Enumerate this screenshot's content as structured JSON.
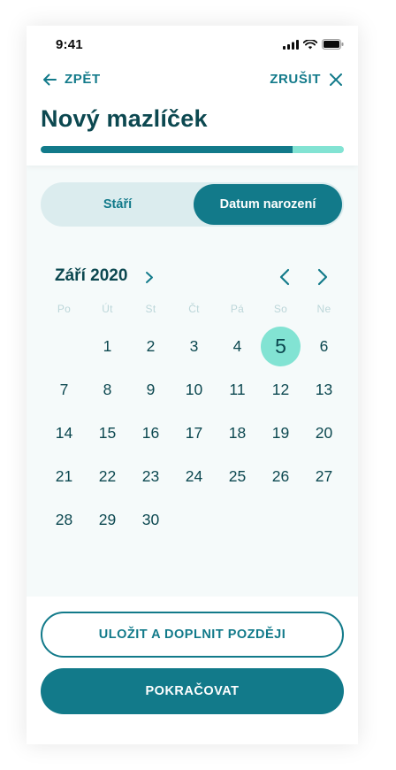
{
  "status": {
    "time": "9:41"
  },
  "nav": {
    "back_label": "ZPĚT",
    "cancel_label": "ZRUŠIT"
  },
  "header": {
    "title": "Nový mazlíček"
  },
  "progress": {
    "value_percent": 83
  },
  "toggle": {
    "options": [
      "Stáří",
      "Datum narození"
    ],
    "selected": "Datum narození"
  },
  "calendar": {
    "month_label": "Září 2020",
    "weekdays": [
      "Po",
      "Út",
      "St",
      "Čt",
      "Pá",
      "So",
      "Ne"
    ],
    "leading_empty": 1,
    "days": [
      "1",
      "2",
      "3",
      "4",
      "5",
      "6",
      "7",
      "8",
      "9",
      "10",
      "11",
      "12",
      "13",
      "14",
      "15",
      "16",
      "17",
      "18",
      "19",
      "20",
      "21",
      "22",
      "23",
      "24",
      "25",
      "26",
      "27",
      "28",
      "29",
      "30"
    ],
    "selected_day": "5"
  },
  "actions": {
    "save_later_label": "ULOŽIT A DOPLNIT POZDĚJI",
    "continue_label": "POKRAČOVAT"
  },
  "colors": {
    "primary": "#127a8a",
    "accent": "#82e3d3",
    "title": "#0c4850",
    "toggle_bg": "#dbecee"
  },
  "icons": [
    "arrow-left-icon",
    "close-icon",
    "chevron-right-icon",
    "chevron-left-icon",
    "signal-icon",
    "wifi-icon",
    "battery-icon"
  ]
}
